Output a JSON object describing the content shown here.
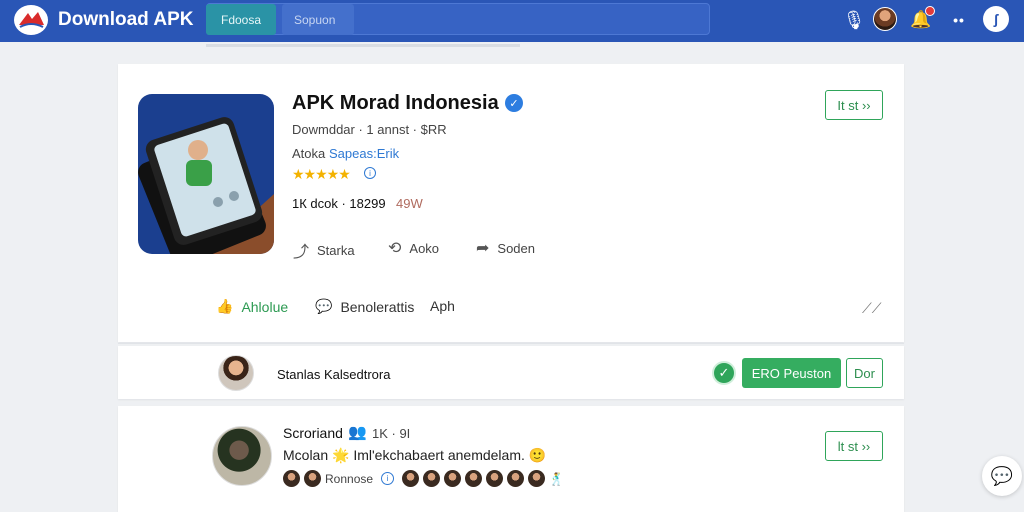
{
  "header": {
    "brand": "Download APK",
    "active_tab": "Fdoosa",
    "search_placeholder": "Sopuon",
    "icons": [
      "mic-icon",
      "avatar",
      "bell-icon",
      "more-icon",
      "profile-icon"
    ],
    "accent": "#2a56b6"
  },
  "app": {
    "title": "APK Morad Indonesia",
    "meta_line": "Dowmddar · 1 annst · $RR",
    "dev_label": "Atoka",
    "dev_link": "Sapeas:Erik",
    "rating_stars": 5,
    "stats": "1К dcok · 18299",
    "size": "49W",
    "actions": [
      {
        "label": "Starka",
        "icon": "share-icon"
      },
      {
        "label": "Aoko",
        "icon": "repost-icon"
      },
      {
        "label": "Soden",
        "icon": "send-icon"
      }
    ],
    "side_button": "It st ››"
  },
  "tabs": {
    "like": "Ahlolue",
    "comments": "Benolerattis",
    "aph": "Aph"
  },
  "follow": {
    "name": "Stanlas Kalsedtrora",
    "primary_button": "ERO Peuston",
    "secondary_button": "Dor"
  },
  "comment": {
    "name": "Scroriand",
    "count": "1K · 9I",
    "text": "Mcolan 🌟 Iml'ekchabaert anemdelam. 🙂",
    "reply_label": "Ronnose",
    "side_button": "lt st ››"
  },
  "colors": {
    "green": "#35ad60",
    "link_blue": "#2f79d3",
    "star": "#f3b200"
  }
}
